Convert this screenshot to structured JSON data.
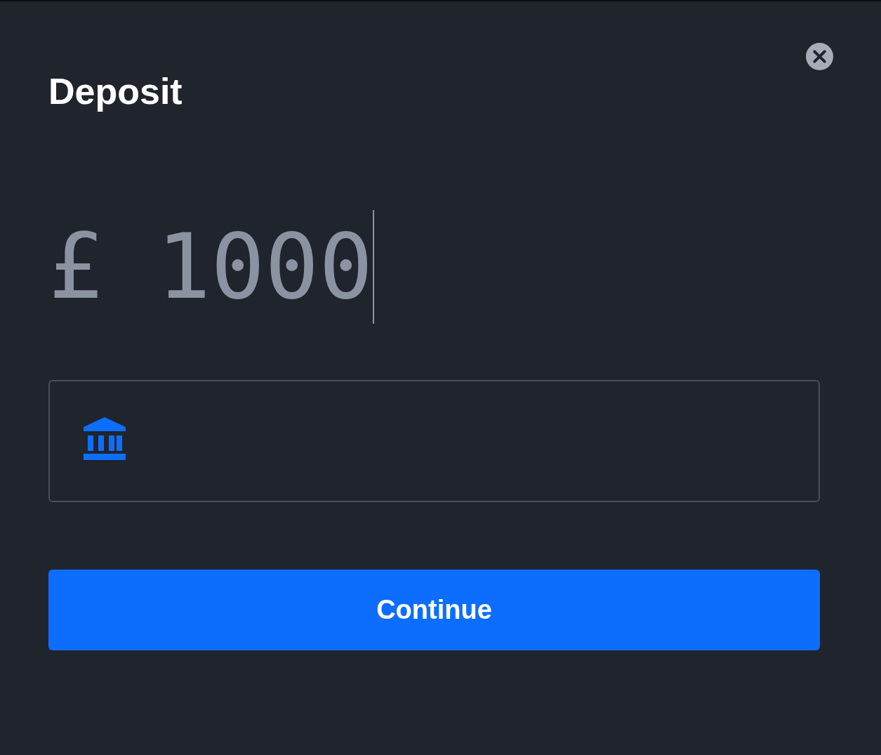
{
  "dialog": {
    "title": "Deposit",
    "amount": {
      "value": "£ 1000",
      "focused": true
    },
    "button": "Continue"
  }
}
